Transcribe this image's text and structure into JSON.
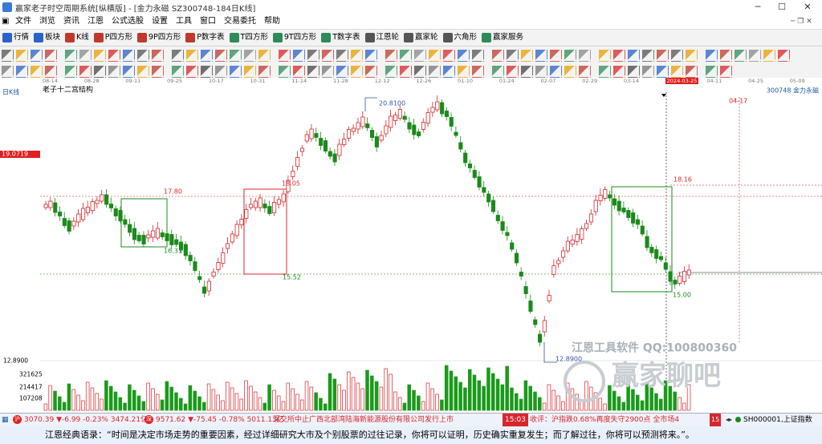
{
  "window": {
    "title": "赢家老子时空周期系统[纵横版] - [金力永磁  SZ300748-184日K线]",
    "min": "─",
    "max": "☐",
    "close": "✕"
  },
  "menu": [
    "文件",
    "浏览",
    "资讯",
    "江恩",
    "公式选股",
    "设置",
    "工具",
    "窗口",
    "交易委托",
    "帮助"
  ],
  "toolbar1": [
    {
      "label": "行情",
      "icon": "grid-icon",
      "color": "#2a62c9"
    },
    {
      "label": "板块",
      "icon": "blocks-icon",
      "color": "#2a62c9"
    },
    {
      "label": "K线",
      "icon": "candlestick-icon",
      "color": "#c0392b"
    },
    {
      "label": "P四方形",
      "icon": "p-square-icon",
      "color": "#c0392b"
    },
    {
      "label": "9P四方形",
      "icon": "9p-square-icon",
      "color": "#c0392b"
    },
    {
      "label": "P数字表",
      "icon": "p-table-icon",
      "color": "#c0392b"
    },
    {
      "label": "T四方形",
      "icon": "t-square-icon",
      "color": "#2e8b57"
    },
    {
      "label": "9T四方形",
      "icon": "9t-square-icon",
      "color": "#2e8b57"
    },
    {
      "label": "T数字表",
      "icon": "t-table-icon",
      "color": "#2e8b57"
    },
    {
      "label": "江恩轮",
      "icon": "gann-wheel-icon",
      "color": "#555"
    },
    {
      "label": "赢家轮",
      "icon": "winner-wheel-icon",
      "color": "#555"
    },
    {
      "label": "六角形",
      "icon": "hexagon-icon",
      "color": "#555"
    },
    {
      "label": "赢家服务",
      "icon": "dollar-icon",
      "color": "#2e8b57"
    }
  ],
  "timeaxis": [
    "08-14",
    "08-28",
    "09-11",
    "09-25",
    "10-17",
    "10-31",
    "11-14",
    "11-28",
    "12-12",
    "12-26",
    "01-10",
    "01-24",
    "02-07",
    "02-29",
    "03-14",
    "2024-03-25",
    "04-11",
    "04-25",
    "05-09"
  ],
  "chart_info": {
    "period": "日K线",
    "title": "老子十二宫结构",
    "stock": "300748  金力永磁",
    "date_marker": "04-17",
    "cursor_price": "19.0719"
  },
  "price_labels": {
    "high": "20.8100",
    "low": "12.8900",
    "l1": "17.80",
    "l2": "16.31",
    "l3": "18.05",
    "l4": "15.52",
    "l5": "18.16",
    "l6": "15.00"
  },
  "vol_labels": [
    "12.8900",
    "321625",
    "214417",
    "107208"
  ],
  "watermark": {
    "line1": "江恩工具软件  QQ:100800360",
    "line2": "赢家聊吧"
  },
  "status": {
    "sh": "3070.39 ▼-6.99 -0.23% 3474.21亿",
    "sz": "9571.62 ▼-75.45 -0.78% 5011.13亿",
    "ticker": "深交所中止广西北部湾陆海新能源股份有限公司发行上市",
    "time": "15:03",
    "close_msg": "收评：沪指跌0.68%再度失守2900点 全市场4",
    "index_code": "SH000001,上证指数"
  },
  "quote": "江恩经典语录：“时间是决定市场走势的重要因素，经过详细研究大市及个别股票的过往记录，你将可以证明，历史确实重复发生；而了解过往，你将可以预测将来。”。",
  "colors": {
    "up": "#d9262b",
    "down": "#1a8a1a",
    "accent": "#e02020",
    "bg": "#ffffff"
  }
}
